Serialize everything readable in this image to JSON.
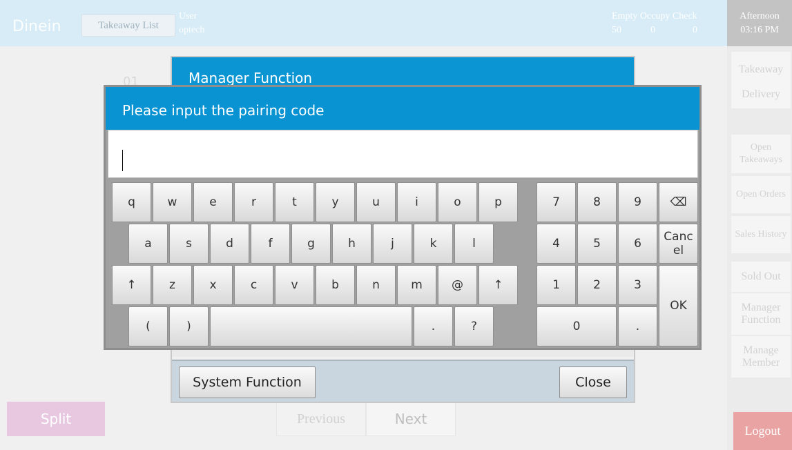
{
  "topbar": {
    "brand": "Dinein",
    "takeaway_list": "Takeaway List",
    "user_label": "User",
    "user_name": "optech",
    "stats": [
      {
        "label": "Empty",
        "value": "50"
      },
      {
        "label": "Occupy",
        "value": "0"
      },
      {
        "label": "Check",
        "value": "0"
      }
    ],
    "period": "Afternoon",
    "time": "03:16 PM"
  },
  "sidebar": {
    "items": [
      "Takeaway",
      "Delivery",
      "Open Takeaways",
      "Open Orders",
      "Sales History",
      "Sold Out",
      "Manager Function",
      "Manage Member"
    ],
    "logout": "Logout"
  },
  "background": {
    "table_number": "01",
    "split": "Split",
    "previous": "Previous",
    "next": "Next"
  },
  "manager_dialog": {
    "title": "Manager Function",
    "system_function": "System Function",
    "close": "Close"
  },
  "pairing_dialog": {
    "title": "Please input the pairing code",
    "input_value": ""
  },
  "keyboard": {
    "row1": [
      "q",
      "w",
      "e",
      "r",
      "t",
      "y",
      "u",
      "i",
      "o",
      "p"
    ],
    "row2": [
      "a",
      "s",
      "d",
      "f",
      "g",
      "h",
      "j",
      "k",
      "l"
    ],
    "row3": [
      "↑",
      "z",
      "x",
      "c",
      "v",
      "b",
      "n",
      "m",
      "@",
      "↑"
    ],
    "row4": [
      "(",
      ")",
      "",
      ".",
      "?"
    ],
    "numpad": [
      "7",
      "8",
      "9",
      "⌫",
      "4",
      "5",
      "6",
      "Canc el",
      "1",
      "2",
      "3",
      "OK",
      "0",
      "."
    ]
  },
  "colors": {
    "header_blue": "#0a93d3",
    "topbar_bg": "#d7ecf7",
    "logout_red": "#eaa3a3",
    "split_pink": "#e8c8e0"
  }
}
